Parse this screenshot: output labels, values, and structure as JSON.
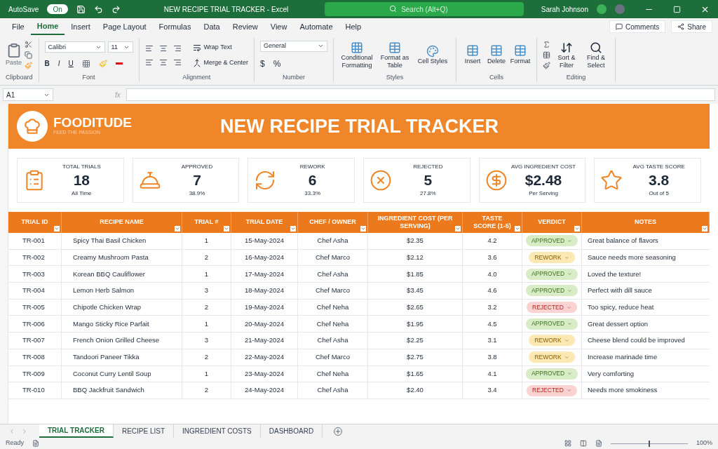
{
  "title_bar": {
    "autosave_label": "AutoSave",
    "autosave_on": true,
    "autosave_state": "On",
    "title": "NEW RECIPE TRIAL TRACKER - Excel",
    "search_placeholder": "Search (Alt+Q)",
    "user": "Sarah Johnson"
  },
  "menu_tabs": [
    {
      "label": "File",
      "selected": false
    },
    {
      "label": "Home",
      "selected": true
    },
    {
      "label": "Insert",
      "selected": false
    },
    {
      "label": "Page Layout",
      "selected": false
    },
    {
      "label": "Formulas",
      "selected": false
    },
    {
      "label": "Data",
      "selected": false
    },
    {
      "label": "Review",
      "selected": false
    },
    {
      "label": "View",
      "selected": false
    },
    {
      "label": "Automate",
      "selected": false
    },
    {
      "label": "Help",
      "selected": false
    }
  ],
  "actions": [
    "Comments",
    "Share"
  ],
  "ribbon": {
    "clipboard": {
      "paste": "Paste",
      "label": "Clipboard"
    },
    "font": {
      "name": "Calibri",
      "size": "11",
      "buttons": [
        "B",
        "I",
        "U"
      ],
      "label": "Font"
    },
    "alignment": {
      "wrap": "Wrap Text",
      "merge": "Merge & Center",
      "label": "Alignment"
    },
    "number": {
      "format": "General",
      "symbols": [
        "$",
        "%"
      ],
      "label": "Number"
    },
    "styles": {
      "items": [
        "Conditional Formatting",
        "Format as Table",
        "Cell Styles"
      ],
      "label": "Styles"
    },
    "cells": {
      "items": [
        "Insert",
        "Delete",
        "Format"
      ],
      "label": "Cells"
    },
    "editing": {
      "items": [
        "Sort & Filter",
        "Find & Select"
      ],
      "label": "Editing"
    }
  },
  "formula_bar": {
    "cell": "A1",
    "fx": "fx"
  },
  "banner": {
    "brand": "FOODITUDE",
    "tagline": "FEED THE PASSION",
    "title": "NEW RECIPE TRIAL TRACKER"
  },
  "kpis": [
    {
      "label": "TOTAL TRIALS",
      "value": "18",
      "note": "All Time"
    },
    {
      "label": "APPROVED",
      "value": "7",
      "note": "38.9%"
    },
    {
      "label": "REWORK",
      "value": "6",
      "note": "33.3%"
    },
    {
      "label": "REJECTED",
      "value": "5",
      "note": "27.8%"
    },
    {
      "label": "AVG INGREDIENT COST",
      "value": "$2.48",
      "note": "Per Serving"
    },
    {
      "label": "AVG TASTE SCORE",
      "value": "3.8",
      "note": "Out of 5"
    }
  ],
  "table": {
    "columns": [
      "TRIAL ID",
      "RECIPE NAME",
      "TRIAL #",
      "TRIAL DATE",
      "CHEF / OWNER",
      "INGREDIENT COST (PER SERVING)",
      "TASTE SCORE (1-5)",
      "VERDICT",
      "NOTES"
    ],
    "rows": [
      {
        "cells": [
          "TR-001",
          "Spicy Thai Basil Chicken",
          "1",
          "15-May-2024",
          "Chef Asha",
          "$2.35",
          "4.2"
        ],
        "verdict": {
          "label": "APPROVED",
          "color": "#d8ecc6"
        },
        "notes": "Great balance of flavors"
      },
      {
        "cells": [
          "TR-002",
          "Creamy Mushroom Pasta",
          "2",
          "16-May-2024",
          "Chef Marco",
          "$2.12",
          "3.6"
        ],
        "verdict": {
          "label": "REWORK",
          "color": "#fce8b2"
        },
        "notes": "Sauce needs more seasoning"
      },
      {
        "cells": [
          "TR-003",
          "Korean BBQ Cauliflower",
          "1",
          "17-May-2024",
          "Chef Asha",
          "$1.85",
          "4.0"
        ],
        "verdict": {
          "label": "APPROVED",
          "color": "#d8ecc6"
        },
        "notes": "Loved the texture!"
      },
      {
        "cells": [
          "TR-004",
          "Lemon Herb Salmon",
          "3",
          "18-May-2024",
          "Chef Marco",
          "$3.45",
          "4.6"
        ],
        "verdict": {
          "label": "APPROVED",
          "color": "#d8ecc6"
        },
        "notes": "Perfect with dill sauce"
      },
      {
        "cells": [
          "TR-005",
          "Chipotle Chicken Wrap",
          "2",
          "19-May-2024",
          "Chef Neha",
          "$2.65",
          "3.2"
        ],
        "verdict": {
          "label": "REJECTED",
          "color": "#fbd3d3"
        },
        "notes": "Too spicy, reduce heat"
      },
      {
        "cells": [
          "TR-006",
          "Mango Sticky Rice Parfait",
          "1",
          "20-May-2024",
          "Chef Neha",
          "$1.95",
          "4.5"
        ],
        "verdict": {
          "label": "APPROVED",
          "color": "#d8ecc6"
        },
        "notes": "Great dessert option"
      },
      {
        "cells": [
          "TR-007",
          "French Onion Grilled Cheese",
          "3",
          "21-May-2024",
          "Chef Asha",
          "$2.25",
          "3.1"
        ],
        "verdict": {
          "label": "REWORK",
          "color": "#fce8b2"
        },
        "notes": "Cheese blend could be improved"
      },
      {
        "cells": [
          "TR-008",
          "Tandoori Paneer Tikka",
          "2",
          "22-May-2024",
          "Chef Marco",
          "$2.75",
          "3.8"
        ],
        "verdict": {
          "label": "REWORK",
          "color": "#fce8b2"
        },
        "notes": "Increase marinade time"
      },
      {
        "cells": [
          "TR-009",
          "Coconut Curry Lentil Soup",
          "1",
          "23-May-2024",
          "Chef Neha",
          "$1.65",
          "4.1"
        ],
        "verdict": {
          "label": "APPROVED",
          "color": "#d8ecc6"
        },
        "notes": "Very comforting"
      },
      {
        "cells": [
          "TR-010",
          "BBQ Jackfruit Sandwich",
          "2",
          "24-May-2024",
          "Chef Asha",
          "$2.40",
          "3.4"
        ],
        "verdict": {
          "label": "REJECTED",
          "color": "#fbd3d3"
        },
        "notes": "Needs more smokiness"
      }
    ]
  },
  "sheet_tabs": [
    {
      "label": "TRIAL TRACKER",
      "selected": true
    },
    {
      "label": "RECIPE LIST",
      "selected": false
    },
    {
      "label": "INGREDIENT COSTS",
      "selected": false
    },
    {
      "label": "DASHBOARD",
      "selected": false
    }
  ],
  "status_bar": {
    "status": "Ready",
    "zoom": "100%",
    "zoom_slider": {
      "level": 0.5
    }
  }
}
